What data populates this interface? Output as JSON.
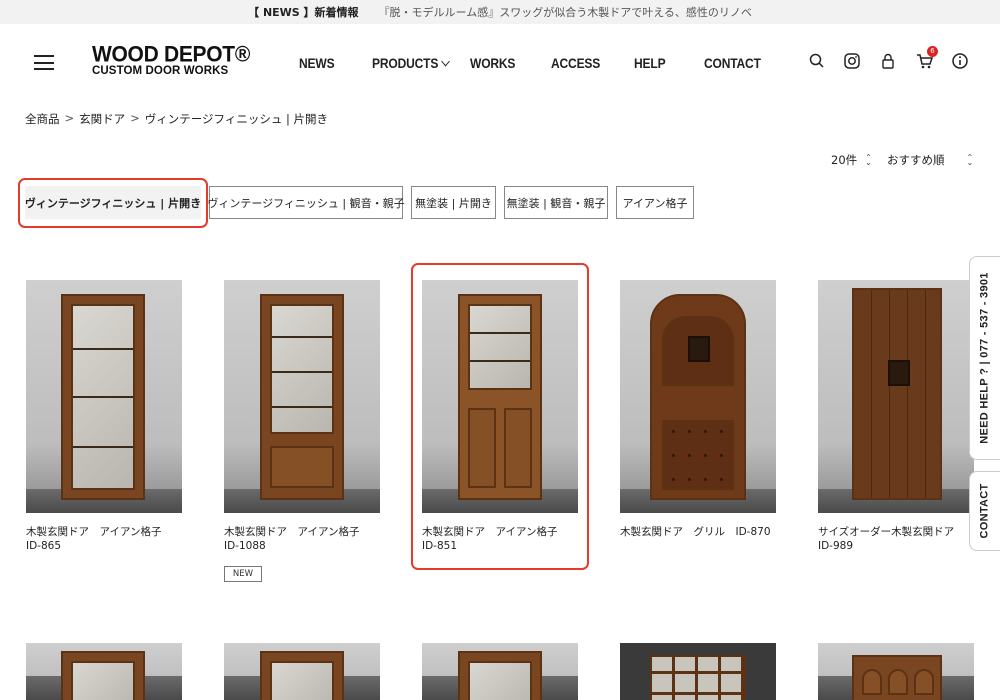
{
  "announcement": {
    "tag": "【 NEWS 】新着情報",
    "message": "『脱・モデルルーム感』スワッグが似合う木製ドアで叶える、感性のリノベ"
  },
  "logo": {
    "line1": "WOOD DEPOT®",
    "line2": "CUSTOM DOOR WORKS"
  },
  "nav": {
    "news": "NEWS",
    "products": "PRODUCTS",
    "works": "WORKS",
    "access": "ACCESS",
    "help": "HELP",
    "contact": "CONTACT"
  },
  "header_icons": {
    "search": "search-icon",
    "instagram": "instagram-icon",
    "account": "lock-icon",
    "cart": "cart-icon",
    "cart_count": "6",
    "info": "info-icon"
  },
  "breadcrumb": {
    "items": [
      "全商品",
      "玄関ドア",
      "ヴィンテージフィニッシュ | 片開き"
    ],
    "separator": ">"
  },
  "sort": {
    "per_page": "20件",
    "order": "おすすめ順"
  },
  "filters": [
    {
      "label": "ヴィンテージフィニッシュ | 片開き",
      "active": true
    },
    {
      "label": "ヴィンテージフィニッシュ | 観音・親子",
      "active": false
    },
    {
      "label": "無塗装 | 片開き",
      "active": false
    },
    {
      "label": "無塗装 | 観音・親子",
      "active": false
    },
    {
      "label": "アイアン格子",
      "active": false
    }
  ],
  "products": [
    {
      "title": "木製玄関ドア　アイアン格子　ID-865",
      "badge": ""
    },
    {
      "title": "木製玄関ドア　アイアン格子　ID-1088",
      "badge": "NEW"
    },
    {
      "title": "木製玄関ドア　アイアン格子　ID-851",
      "badge": ""
    },
    {
      "title": "木製玄関ドア　グリル　ID-870",
      "badge": ""
    },
    {
      "title": "サイズオーダー木製玄関ドア　ID-989",
      "badge": ""
    }
  ],
  "side_tabs": {
    "help": "NEED HELP ?  |  077 - 537 - 3901",
    "contact": "CONTACT"
  },
  "colors": {
    "highlight": "#e53a2c",
    "wood": "#7a4621",
    "badge": "#dd2222"
  }
}
